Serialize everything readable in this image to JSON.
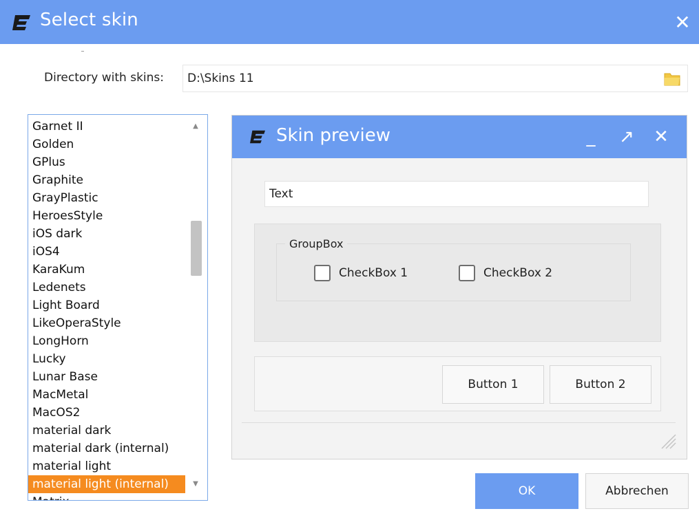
{
  "window": {
    "title": "Select skin",
    "close_label": "✕"
  },
  "directory": {
    "label": "Directory with skins:",
    "value": "D:\\Skins 11"
  },
  "skin_list": {
    "items": [
      "Garnet II",
      "Golden",
      "GPlus",
      "Graphite",
      "GrayPlastic",
      "HeroesStyle",
      "iOS dark",
      "iOS4",
      "KaraKum",
      "Ledenets",
      "Light Board",
      "LikeOperaStyle",
      "LongHorn",
      "Lucky",
      "Lunar Base",
      "MacMetal",
      "MacOS2",
      "material dark",
      "material dark (internal)",
      "material light",
      "material light (internal)",
      "Matrix"
    ],
    "selected": "material light (internal)"
  },
  "preview": {
    "title": "Skin preview",
    "minimize_label": "_",
    "maximize_label": "↗",
    "close_label": "✕",
    "text_value": "Text",
    "groupbox_label": "GroupBox",
    "checkbox1_label": "CheckBox 1",
    "checkbox2_label": "CheckBox 2",
    "button1_label": "Button 1",
    "button2_label": "Button 2"
  },
  "footer": {
    "ok_label": "OK",
    "cancel_label": "Abbrechen"
  },
  "colors": {
    "titlebar": "#6b9cf0",
    "selection": "#f58b1f",
    "list_border": "#7aa8e8"
  }
}
